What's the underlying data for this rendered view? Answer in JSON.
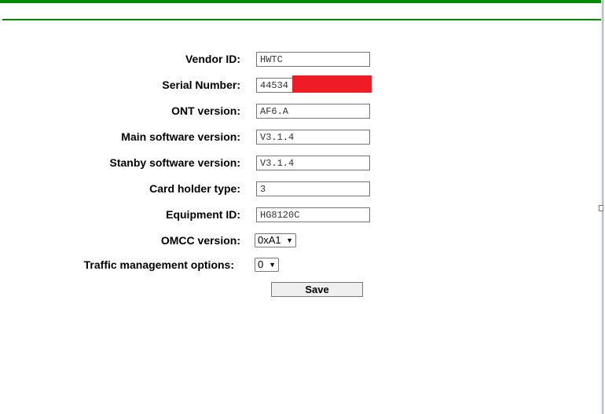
{
  "form": {
    "vendor_id_label": "Vendor ID:",
    "vendor_id_value": "HWTC",
    "serial_number_label": "Serial Number:",
    "serial_number_value": "44534",
    "ont_version_label": "ONT version:",
    "ont_version_value": "AF6.A",
    "main_software_version_label": "Main software version:",
    "main_software_version_value": "V3.1.4",
    "standby_software_version_label": "Stanby software version:",
    "standby_software_version_value": "V3.1.4",
    "card_holder_type_label": "Card holder type:",
    "card_holder_type_value": "3",
    "equipment_id_label": "Equipment ID:",
    "equipment_id_value": "HG8120C",
    "omcc_version_label": "OMCC version:",
    "omcc_version_selected": "0xA1",
    "traffic_management_label": "Traffic management options:",
    "traffic_management_selected": "0",
    "save_label": "Save"
  },
  "icons": {
    "dropdown": "chevron-down-icon"
  },
  "colors": {
    "accent_line": "#008a00",
    "redaction": "#ee1c25"
  }
}
